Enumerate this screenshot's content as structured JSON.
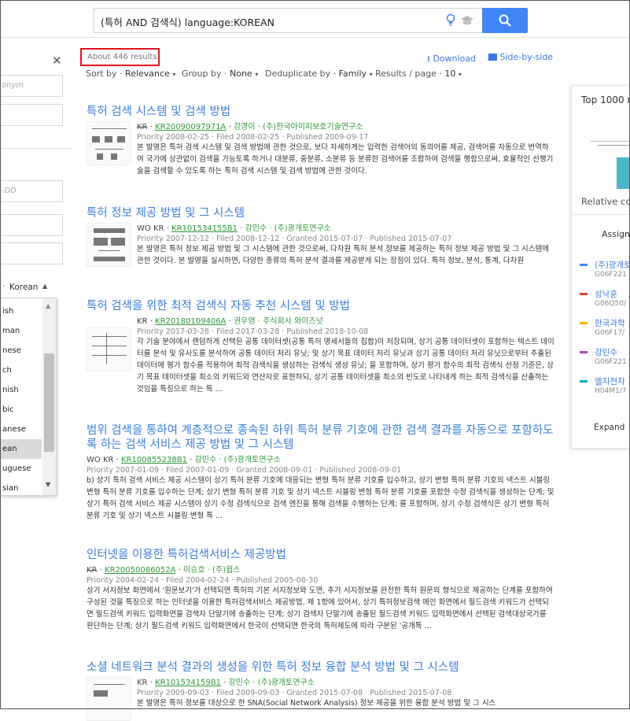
{
  "search": {
    "query": "(특허 AND 검색식) language:KOREAN"
  },
  "left_panel": {
    "field1_placeholder": "onym",
    "date_placeholder": "-DD",
    "language_selected": "Korean",
    "languages": [
      "ish",
      "man",
      "nese",
      "ch",
      "nish",
      "bic",
      "anese",
      "ean",
      "uguese",
      "sian"
    ],
    "selected_index": 7
  },
  "results_header": {
    "count": "About 446 results",
    "download": "Download",
    "side_by_side": "Side-by-side",
    "sort_label": "Sort by",
    "sort_value": "Relevance",
    "group_label": "Group by",
    "group_value": "None",
    "dedup_label": "Deduplicate by",
    "dedup_value": "Family",
    "perpage_label": "Results / page",
    "perpage_value": "10"
  },
  "results": [
    {
      "title": "특허 검색 시스템 및 검색 방법",
      "office": "KR",
      "number": "KR20090097971A",
      "people": "강경이 · (주)한국아이피보호기술연구소",
      "dates": "Priority 2008-02-25 · Filed 2008-02-25 · Published 2009-09-17",
      "snippet": "본 발명은 특허 검색 시스템 및 검색 방법에 관한 것으로, 보다 자세하게는 입력한 검색어의 동의어를 제공, 검색어를 자동으로 번역하여 국가에 상관없이 검색을 가능토록 하거나 대분류, 중분류, 소분류 등 분류한 검색어를 조합하여 검색을 행함으로써, 효율적인 선행기술을 검색할 수 있도록 하는 특허 검색 시스템 및 검색 방법에 관한 것이다."
    },
    {
      "title": "특허 정보 제공 방법 및 그 시스템",
      "office": "WO KR",
      "number": "KR101534155B1",
      "people": "강민수 · (주)광개토연구소",
      "dates": "Priority 2007-12-12 · Filed 2008-12-12 · Granted 2015-07-07 · Published 2015-07-07",
      "snippet": "본 발명은 특허 정보 제공 방법 및 그 시스템에 관한 것으로써, 다차원 특허 분석 정보를 제공하는 특허 정보 제공 방법 및 그 시스템에 관한 것이다. 본 발명을 실시하면, 다양한 종류의 특허 분석 결과를 제공받게 되는 장점이 있다. 특허 정보, 분석, 통계, 다차원"
    },
    {
      "title": "특허 검색을 위한 최적 검색식 자동 추천 시스템 및 방법",
      "office": "KR",
      "number": "KR20180109406A",
      "people": "권우영 · 주식회사 와이즈넛",
      "dates": "Priority 2017-03-28 · Filed 2017-03-28 · Published 2018-10-08",
      "snippet": "각 기술 분야에서 랜덤하게 선택된 공통 데이터셋(공통 특허 명세서들의 집합)이 저장되며, 상기 공통 데이터셋이 포함하는 텍스트 데이터를 분석 및 유사도를 분석하여 공통 데이터 처리 유닛; 및 상기 목표 데이터 처리 유닛과 상기 공통 데이터 처리 유닛으로부터 추출된 데이터에 평가 함수를 적용하여 최적 검색식을 생성하는 검색식 생성 유닛; 을 포함하며, 상기 평가 함수의 최적 검색식 선정 기준은, 상기 목표 데이터셋을 최소의 키워드와 연산자로 표현하되, 상기 공통 데이터셋을 최소의 빈도로 나타내게 하는 최적 검색식을 산출하는 것임을 특징으로 하는 특 ..."
    },
    {
      "title": "범위 검색을 통하여 계층적으로 종속된 하위 특허 분류 기호에 관한 검색 결과를 자동으로 포함하도록 하는 검색 서비스 제공 방법 및 그 시스템",
      "office": "WO KR",
      "number": "KR100855238B1",
      "people": "강민수 · (주)광개토연구소",
      "dates": "Priority 2007-01-09 · Filed 2007-01-09 · Granted 2008-09-01 · Published 2008-09-01",
      "snippet": "b) 상기 특허 검색 서비스 제공 시스템이 상기 특허 분류 기호에 대응되는 변형 특허 분류 기호를 입수하고, 상기 변형 특허 분류 기호의 넥스트 시블링 변형 특허 분류 기호를 입수하는 단계; 상기 변형 특허 분류 기호 및 상기 넥스트 시블링 변형 특허 분류 기호를 포함한 수정 검색식을 생성하는 단계; 및 상기 특허 검색 서비스 제공 시스템이 상기 수정 검색식으로 검색 엔진을 통해 검색을 수행하는 단계; 를 포함하며, 상기 수정 검색식은 상기 변형 특허 분류 기호 및 상기 넥스트 시블링 변형 특 ..."
    },
    {
      "title": "인터넷을 이용한 특허검색서비스 제공방법",
      "office": "KR",
      "number": "KR20050086052A",
      "people": "이승호 · (주)윕스",
      "dates": "Priority 2004-02-24 · Filed 2004-02-24 · Published 2005-08-30",
      "snippet": "상기 서지정보 화면에서 '원문보기'가 선택되면 특허의 기본 서지정보와 도면, 추가 서지정보를 완전한 특허 원문의 형식으로 제공하는 단계를 포함하여 구성된 것을 특징으로 하는 인터넷을 이용한 특허검색서비스 제공방법. 제 1항에 있어서, 상기 특허정보검색 메인 화면에서 필드검색 키워드가 선택되면 필드검색 키워드 입력화면을 검색자 단말기에 송출하는 단계; 상기 검색자 단말기에 송출된 필드검색 키워드 입력화면에서 선택된 검색대상국가를 판단하는 단계; 상기 필드검색 키워드 입력화면에서 한국이 선택되면 한국의 특허제도에 따라 구분된 '공개특 ..."
    },
    {
      "title": "소셜 네트워크 분석 결과의 생성을 위한 특허 정보 융합 분석 방법 및 그 시스템",
      "office": "KR",
      "number": "KR101534159B1",
      "people": "강민수 · (주)광개토연구소",
      "dates": "Priority 2009-09-03 · Filed 2009-09-03 · Granted 2015-07-08 · Published 2015-07-08",
      "snippet": "본 발명은 특허 정보를 대상으로 한 SNA(Social Network Analysis) 정보 제공을 위한 융합 분석 방법 및 그 시스"
    }
  ],
  "right_panel": {
    "title": "Top 1000 r",
    "relative": "Relative co",
    "assignee_header": "Assign",
    "legend": [
      {
        "name": "(주)광개토",
        "code": "G06F221",
        "color": "#4285f4"
      },
      {
        "name": "성낙훈",
        "code": "G06Q50/",
        "color": "#db4437"
      },
      {
        "name": "한국과학",
        "code": "G06F17/",
        "color": "#f4b400"
      },
      {
        "name": "강민수",
        "code": "G06F221",
        "color": "#ab47bc"
      },
      {
        "name": "엘지전자",
        "code": "H04M1/7",
        "color": "#00acc1"
      }
    ],
    "expand": "Expand"
  }
}
